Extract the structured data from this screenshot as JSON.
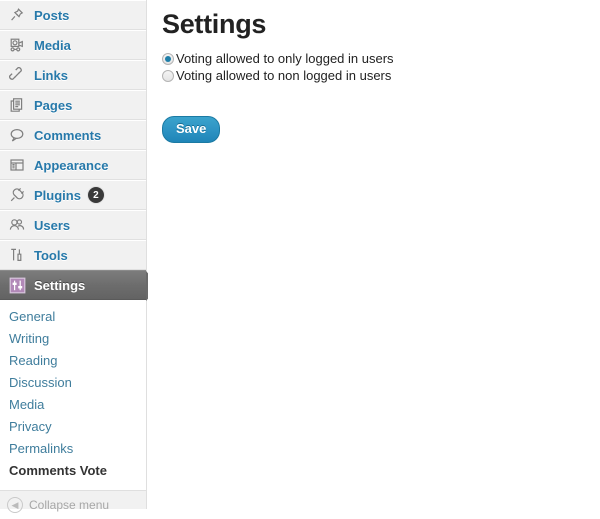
{
  "sidebar": {
    "menu": [
      {
        "label": "Posts",
        "icon": "pin-icon",
        "badge": null,
        "current": false
      },
      {
        "label": "Media",
        "icon": "camera-icon",
        "badge": null,
        "current": false
      },
      {
        "label": "Links",
        "icon": "link-icon",
        "badge": null,
        "current": false
      },
      {
        "label": "Pages",
        "icon": "pages-icon",
        "badge": null,
        "current": false
      },
      {
        "label": "Comments",
        "icon": "speech-bubble-icon",
        "badge": null,
        "current": false
      },
      {
        "label": "Appearance",
        "icon": "layout-icon",
        "badge": null,
        "current": false
      },
      {
        "label": "Plugins",
        "icon": "plug-icon",
        "badge": "2",
        "current": false
      },
      {
        "label": "Users",
        "icon": "users-icon",
        "badge": null,
        "current": false
      },
      {
        "label": "Tools",
        "icon": "tools-icon",
        "badge": null,
        "current": false
      },
      {
        "label": "Settings",
        "icon": "sliders-icon",
        "badge": null,
        "current": true
      }
    ],
    "submenu": [
      {
        "label": "General",
        "current": false
      },
      {
        "label": "Writing",
        "current": false
      },
      {
        "label": "Reading",
        "current": false
      },
      {
        "label": "Discussion",
        "current": false
      },
      {
        "label": "Media",
        "current": false
      },
      {
        "label": "Privacy",
        "current": false
      },
      {
        "label": "Permalinks",
        "current": false
      },
      {
        "label": "Comments Vote",
        "current": true
      }
    ],
    "collapse_label": "Collapse menu"
  },
  "main": {
    "title": "Settings",
    "options": [
      {
        "label": "Voting allowed to only logged in users",
        "checked": true
      },
      {
        "label": "Voting allowed to non logged in users",
        "checked": false
      }
    ],
    "save_label": "Save"
  },
  "colors": {
    "menu_link": "#2779aa",
    "submenu_link": "#3f7d9c",
    "current_menu_bg": "#6d6d6d",
    "save_button": "#2e94c4",
    "radio_selected": "#1e7ea8",
    "badge_bg": "#3a3a3a"
  }
}
